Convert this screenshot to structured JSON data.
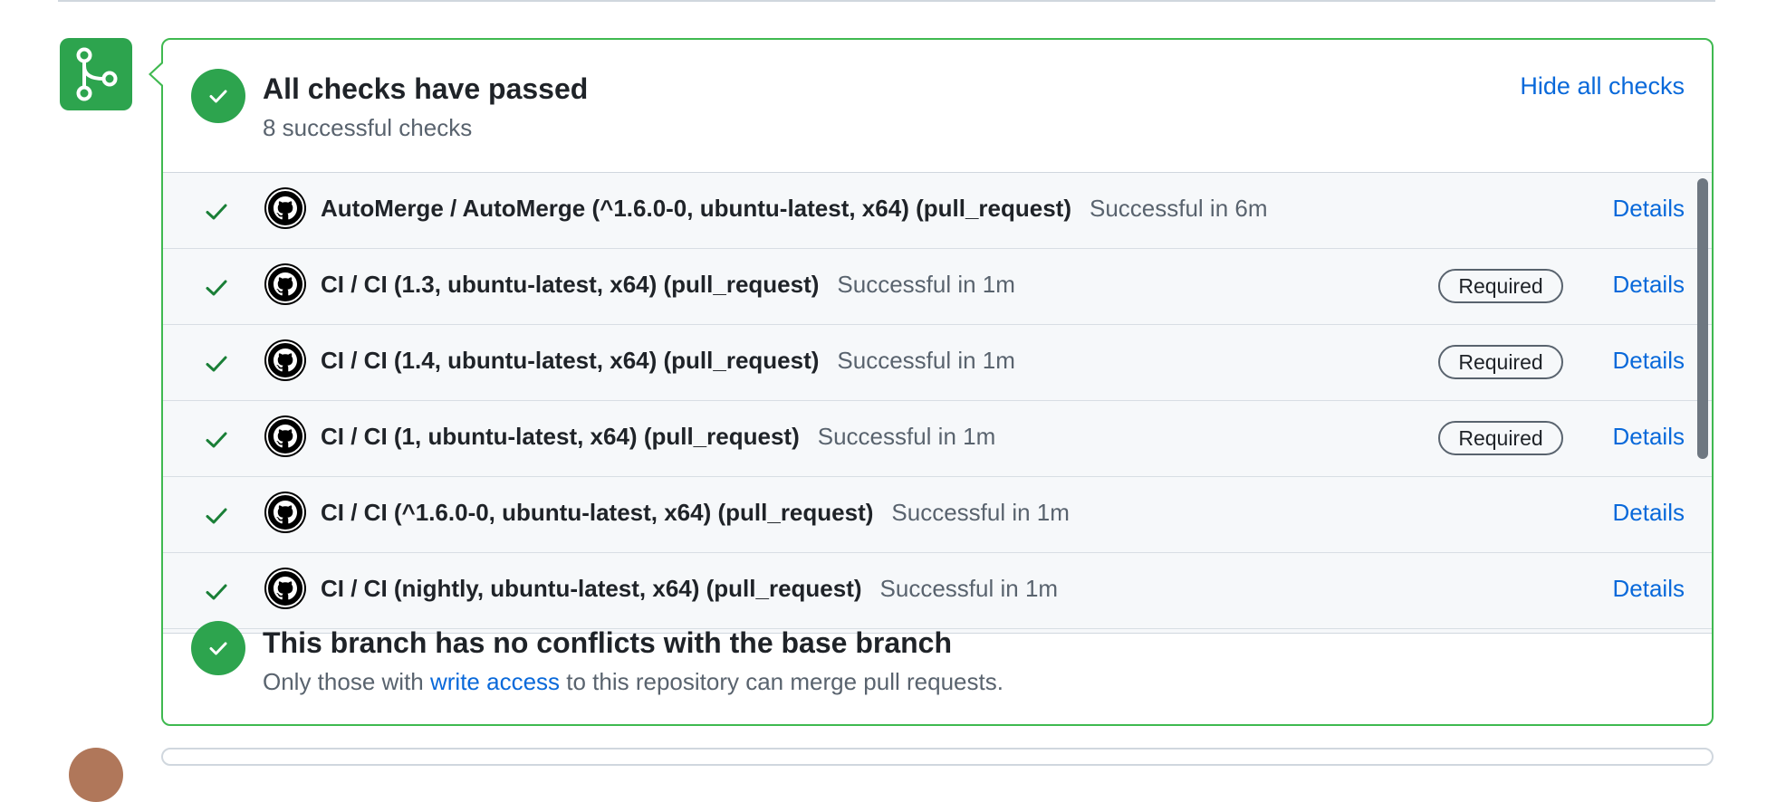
{
  "header": {
    "title": "All checks have passed",
    "subtitle": "8 successful checks",
    "hide_label": "Hide all checks"
  },
  "checks": [
    {
      "name": "AutoMerge / AutoMerge (^1.6.0-0, ubuntu-latest, x64) (pull_request)",
      "status": "Successful in 6m",
      "required": "",
      "details": "Details"
    },
    {
      "name": "CI / CI (1.3, ubuntu-latest, x64) (pull_request)",
      "status": "Successful in 1m",
      "required": "Required",
      "details": "Details"
    },
    {
      "name": "CI / CI (1.4, ubuntu-latest, x64) (pull_request)",
      "status": "Successful in 1m",
      "required": "Required",
      "details": "Details"
    },
    {
      "name": "CI / CI (1, ubuntu-latest, x64) (pull_request)",
      "status": "Successful in 1m",
      "required": "Required",
      "details": "Details"
    },
    {
      "name": "CI / CI (^1.6.0-0, ubuntu-latest, x64) (pull_request)",
      "status": "Successful in 1m",
      "required": "",
      "details": "Details"
    },
    {
      "name": "CI / CI (nightly, ubuntu-latest, x64) (pull_request)",
      "status": "Successful in 1m",
      "required": "",
      "details": "Details"
    }
  ],
  "merge": {
    "title": "This branch has no conflicts with the base branch",
    "text_before": "Only those with ",
    "link": "write access",
    "text_after": " to this repository can merge pull requests."
  },
  "icons": {
    "merge_badge": "git-branch-icon",
    "status": "check-circle-icon",
    "row_status": "check-icon",
    "app": "github-icon"
  },
  "colors": {
    "success": "#2da44e",
    "border": "#3fb950",
    "link": "#0969da"
  }
}
